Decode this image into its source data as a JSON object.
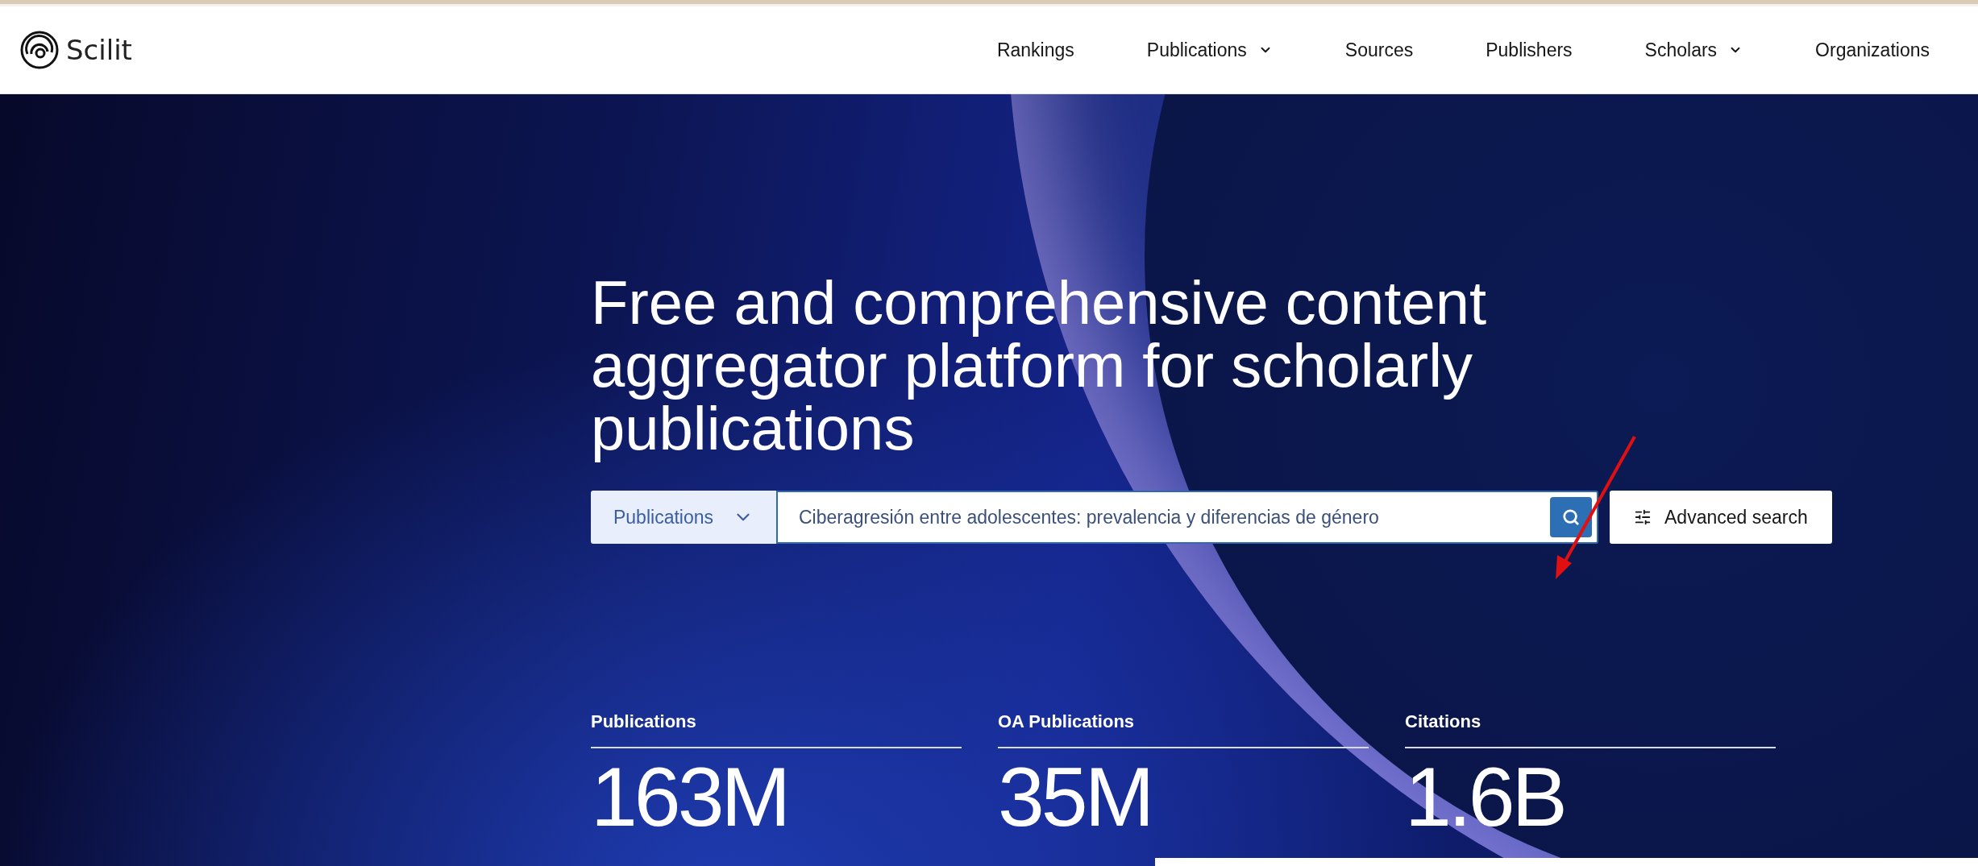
{
  "header": {
    "logo": "Scilit",
    "nav": [
      {
        "label": "Rankings",
        "has_dropdown": false
      },
      {
        "label": "Publications",
        "has_dropdown": true
      },
      {
        "label": "Sources",
        "has_dropdown": false
      },
      {
        "label": "Publishers",
        "has_dropdown": false
      },
      {
        "label": "Scholars",
        "has_dropdown": true
      },
      {
        "label": "Organizations",
        "has_dropdown": false
      }
    ]
  },
  "hero": {
    "title": "Free and comprehensive content aggregator platform for scholarly publications",
    "search": {
      "scope": "Publications",
      "value": "Ciberagresión entre adolescentes: prevalencia y diferencias de género",
      "advanced_label": "Advanced search"
    },
    "stats": [
      {
        "label": "Publications",
        "value": "163M"
      },
      {
        "label": "OA Publications",
        "value": "35M"
      },
      {
        "label": "Citations",
        "value": "1.6B"
      }
    ]
  }
}
